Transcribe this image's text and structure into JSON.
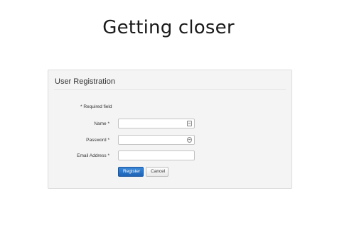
{
  "slide": {
    "title": "Getting closer"
  },
  "form": {
    "header": "User Registration",
    "required_note": "* Required field",
    "fields": [
      {
        "label": "Name *",
        "value": "",
        "icon": "contact-card-icon"
      },
      {
        "label": "Password *",
        "value": "",
        "icon": "key-icon"
      },
      {
        "label": "Email Address *",
        "value": "",
        "icon": ""
      }
    ],
    "buttons": {
      "register": "Register",
      "cancel": "Cancel"
    },
    "colors": {
      "primary_button": "#2a74c8",
      "panel_background": "#f4f4f4"
    }
  }
}
